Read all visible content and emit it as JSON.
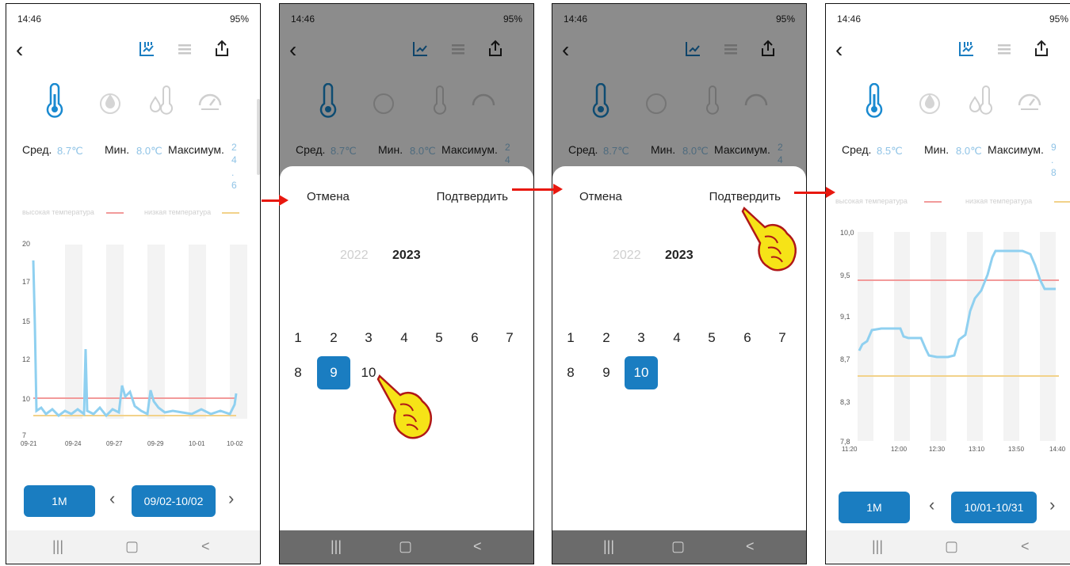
{
  "status": {
    "time": "14:46",
    "icons_left": "⌸⌸◙",
    "battery": "95%",
    "signal": "⚟ᵂⁱᶠⁱ.ıl"
  },
  "toolbar": {
    "back_icon": "chevron-left-icon",
    "chart_icon": "chart-icon",
    "list_icon": "list-icon",
    "share_icon": "share-icon"
  },
  "sensors": [
    "thermometer-icon",
    "humidity-drop-icon",
    "thermo-hygro-icon",
    "pressure-gauge-icon"
  ],
  "screens": [
    {
      "stats": {
        "avg_label": "Сред.",
        "avg_value": "8.7℃",
        "min_label": "Мин.",
        "min_value": "8.0℃",
        "max_label": "Максимум.",
        "max_digits": [
          "2",
          "4",
          ".",
          "6"
        ]
      },
      "legend": {
        "high": "высокая температура",
        "low": "низкая температура"
      },
      "chart": {
        "y_ticks": [
          "20",
          "17",
          "15",
          "12",
          "10",
          "7"
        ],
        "x_ticks": [
          "09-21",
          "09-24",
          "09-27",
          "09-29",
          "10-01",
          "10-02"
        ]
      },
      "period_button": "1M",
      "date_range": "09/02-10/02"
    },
    {
      "stats": {
        "avg_label": "Сред.",
        "avg_value": "8.7℃",
        "min_label": "Мин.",
        "min_value": "8.0℃",
        "max_label": "Максимум.",
        "max_digits": [
          "2",
          "4"
        ]
      },
      "picker": {
        "cancel": "Отмена",
        "confirm": "Подтвердить",
        "year_prev": "2022",
        "year_current": "2023",
        "months": [
          "1",
          "2",
          "3",
          "4",
          "5",
          "6",
          "7",
          "8",
          "9",
          "10"
        ],
        "selected_month": "9"
      }
    },
    {
      "stats": {
        "avg_label": "Сред.",
        "avg_value": "8.7℃",
        "min_label": "Мин.",
        "min_value": "8.0℃",
        "max_label": "Максимум.",
        "max_digits": [
          "2",
          "4"
        ]
      },
      "picker": {
        "cancel": "Отмена",
        "confirm": "Подтвердить",
        "year_prev": "2022",
        "year_current": "2023",
        "months": [
          "1",
          "2",
          "3",
          "4",
          "5",
          "6",
          "7",
          "8",
          "9",
          "10"
        ],
        "selected_month": "10"
      }
    },
    {
      "stats": {
        "avg_label": "Сред.",
        "avg_value": "8.5℃",
        "min_label": "Мин.",
        "min_value": "8.0℃",
        "max_label": "Максимум.",
        "max_digits": [
          "9",
          ".",
          "8"
        ]
      },
      "legend": {
        "high": "высокая температура",
        "low": "низкая температура"
      },
      "chart": {
        "y_ticks": [
          "10,0",
          "9,5",
          "9,1",
          "8,7",
          "8,3",
          "7,8"
        ],
        "x_ticks": [
          "11:20",
          "12:00",
          "12:30",
          "13:10",
          "13:50",
          "14:40"
        ]
      },
      "period_button": "1M",
      "date_range": "10/01-10/31"
    }
  ],
  "nav": {
    "recent": "|||",
    "home": "▢",
    "back": "<"
  },
  "colors": {
    "accent": "#1a7dc1",
    "series": "#8fd0f0",
    "high_line": "#f29a9a",
    "low_line": "#f2d28a",
    "arrow": "#e8180f"
  }
}
